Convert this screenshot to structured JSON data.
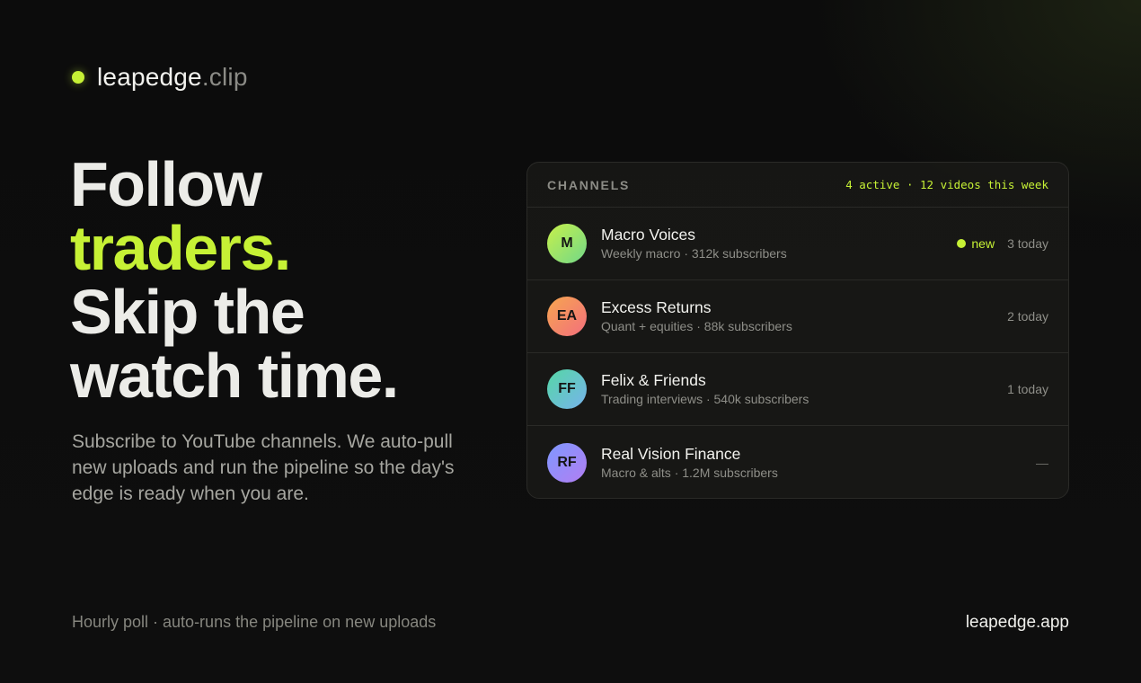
{
  "brand": {
    "name": "leapedge",
    "suffix": ".clip"
  },
  "headline": {
    "line1": "Follow",
    "line2": "traders.",
    "line3": "Skip the",
    "line4": "watch time."
  },
  "subtext": "Subscribe to YouTube channels. We auto-pull new uploads and run the pipeline so the day's edge is ready when you are.",
  "footer": {
    "note": "Hourly poll · auto-runs the pipeline on new uploads",
    "domain": "leapedge.app"
  },
  "panel": {
    "title": "CHANNELS",
    "meta": "4 active · 12 videos this week",
    "channels": [
      {
        "initials": "M",
        "name": "Macro Voices",
        "desc": "Weekly macro · 312k subscribers",
        "badge": "new",
        "count": "3 today"
      },
      {
        "initials": "EA",
        "name": "Excess Returns",
        "desc": "Quant + equities · 88k subscribers",
        "count": "2 today"
      },
      {
        "initials": "FF",
        "name": "Felix & Friends",
        "desc": "Trading interviews · 540k subscribers",
        "count": "1 today"
      },
      {
        "initials": "RF",
        "name": "Real Vision Finance",
        "desc": "Macro & alts · 1.2M subscribers",
        "count": "—"
      }
    ]
  },
  "colors": {
    "accent": "#c6f135",
    "background": "#0d0d0d"
  }
}
